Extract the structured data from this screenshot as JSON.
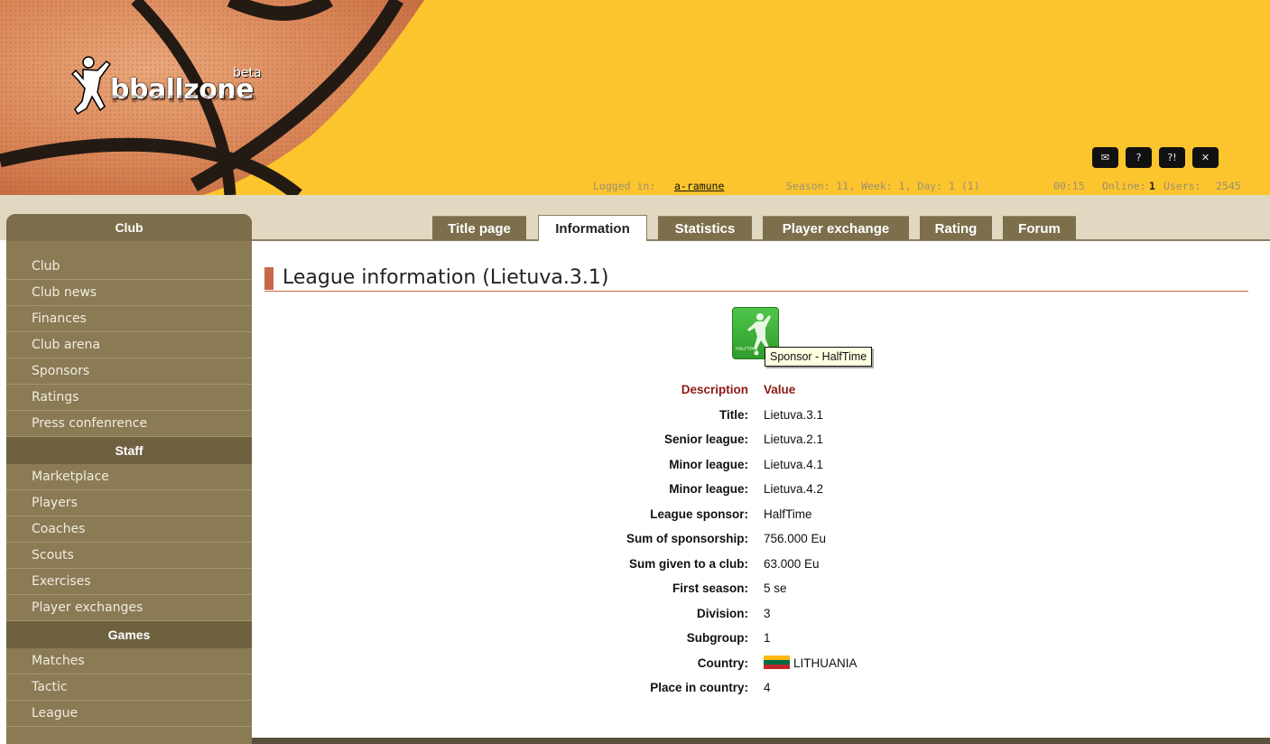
{
  "header": {
    "logo_text": "bballzone",
    "logo_badge": "beta",
    "icons": [
      {
        "name": "mail-icon",
        "glyph": "✉"
      },
      {
        "name": "help-icon",
        "glyph": "?"
      },
      {
        "name": "faq-icon",
        "glyph": "?!"
      },
      {
        "name": "close-icon",
        "glyph": "✕"
      }
    ]
  },
  "status": {
    "logged_in_label": "Logged in:",
    "logged_in_user": "a-ramune",
    "season_text": "Season: 11, Week: 1, Day: 1 (1)",
    "time": "00:15",
    "online_label": "Online:",
    "online_count": "1",
    "users_label": "Users:",
    "users_count": "2545"
  },
  "tabs": [
    {
      "label": "Title page",
      "active": false
    },
    {
      "label": "Information",
      "active": true
    },
    {
      "label": "Statistics",
      "active": false
    },
    {
      "label": "Player exchange",
      "active": false
    },
    {
      "label": "Rating",
      "active": false
    },
    {
      "label": "Forum",
      "active": false
    }
  ],
  "sidebar": {
    "sections": [
      {
        "title": "Club",
        "items": [
          "Club",
          "Club news",
          "Finances",
          "Club arena",
          "Sponsors",
          "Ratings",
          "Press confenrence"
        ]
      },
      {
        "title": "Staff",
        "items": [
          "Marketplace",
          "Players",
          "Coaches",
          "Scouts",
          "Exercises",
          "Player exchanges"
        ]
      },
      {
        "title": "Games",
        "items": [
          "Matches",
          "Tactic",
          "League"
        ]
      }
    ]
  },
  "content": {
    "title": "League information (Lietuva.3.1)",
    "sponsor_logo_text": "HALFTIME",
    "sponsor_tooltip": "Sponsor - HalfTime",
    "table_header": {
      "label": "Description",
      "value": "Value"
    },
    "rows": [
      {
        "label": "Title:",
        "value": "Lietuva.3.1"
      },
      {
        "label": "Senior league:",
        "value": "Lietuva.2.1"
      },
      {
        "label": "Minor league:",
        "value": "Lietuva.4.1"
      },
      {
        "label": "Minor league:",
        "value": "Lietuva.4.2"
      },
      {
        "label": "League sponsor:",
        "value": "HalfTime"
      },
      {
        "label": "Sum of sponsorship:",
        "value": "756.000 Eu"
      },
      {
        "label": "Sum given to a club:",
        "value": "63.000 Eu"
      },
      {
        "label": "First season:",
        "value": "5 se"
      },
      {
        "label": "Division:",
        "value": "3"
      },
      {
        "label": "Subgroup:",
        "value": "1"
      },
      {
        "label": "Country:",
        "value": "LITHUANIA",
        "flag": true
      },
      {
        "label": "Place in country:",
        "value": "4"
      }
    ]
  },
  "colors": {
    "header_yellow": "#fcc52d",
    "sidebar_brown": "#8a7b55",
    "tab_brown": "#7d6f4c",
    "accent_red": "#c8674a",
    "table_head_red": "#8b1a14",
    "flag_yellow": "#fdb913",
    "flag_green": "#006a44",
    "flag_red": "#c1272d"
  }
}
